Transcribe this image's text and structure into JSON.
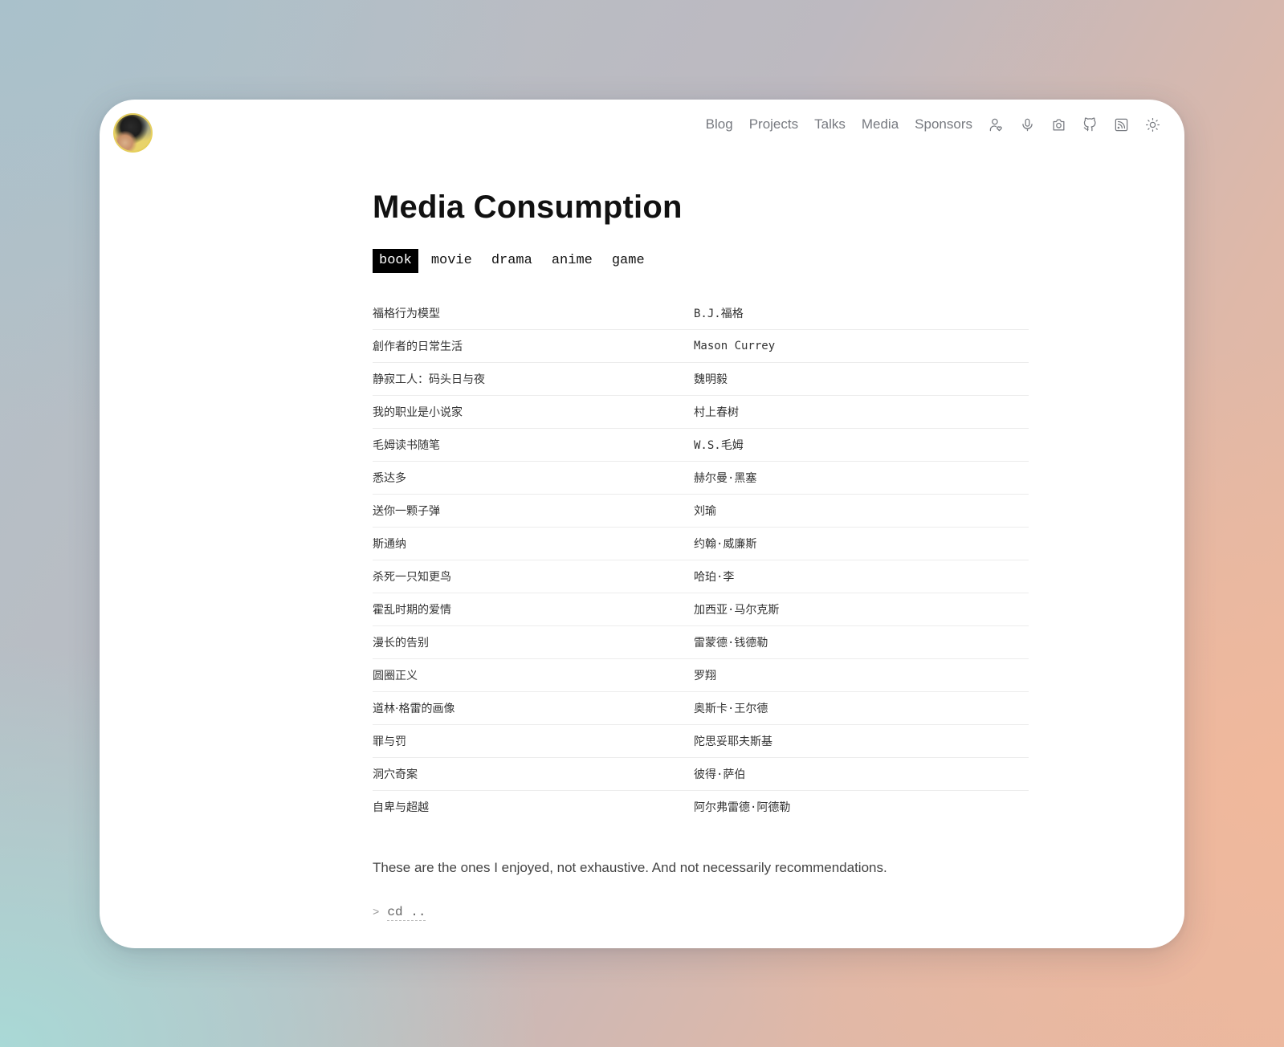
{
  "nav": {
    "links": [
      "Blog",
      "Projects",
      "Talks",
      "Media",
      "Sponsors"
    ],
    "icons": [
      "person-heart-icon",
      "microphone-icon",
      "camera-icon",
      "github-icon",
      "rss-icon",
      "sun-icon"
    ]
  },
  "page": {
    "title": "Media Consumption",
    "tabs": [
      "book",
      "movie",
      "drama",
      "anime",
      "game"
    ],
    "active_tab": "book",
    "books": [
      {
        "name": "福格行为模型",
        "author": "B.J.福格"
      },
      {
        "name": "創作者的日常生活",
        "author": "Mason Currey"
      },
      {
        "name": "静寂工人：码头日与夜",
        "author": "魏明毅"
      },
      {
        "name": "我的职业是小说家",
        "author": "村上春树"
      },
      {
        "name": "毛姆读书随笔",
        "author": "W.S.毛姆"
      },
      {
        "name": "悉达多",
        "author": "赫尔曼·黑塞"
      },
      {
        "name": "送你一颗子弹",
        "author": "刘瑜"
      },
      {
        "name": "斯通纳",
        "author": "约翰·威廉斯"
      },
      {
        "name": "杀死一只知更鸟",
        "author": "哈珀·李"
      },
      {
        "name": "霍乱时期的爱情",
        "author": "加西亚·马尔克斯"
      },
      {
        "name": "漫长的告别",
        "author": "雷蒙德·钱德勒"
      },
      {
        "name": "圆圈正义",
        "author": "罗翔"
      },
      {
        "name": "道林·格雷的画像",
        "author": "奥斯卡·王尔德"
      },
      {
        "name": "罪与罚",
        "author": "陀思妥耶夫斯基"
      },
      {
        "name": "洞穴奇案",
        "author": "彼得·萨伯"
      },
      {
        "name": "自卑与超越",
        "author": "阿尔弗雷德·阿德勒"
      }
    ],
    "note": "These are the ones I enjoyed, not exhaustive. And not necessarily recommendations.",
    "back_chevron": ">",
    "back_command": "cd .."
  },
  "colors": {
    "active_tab_bg": "#000000",
    "nav_text": "#777a80"
  }
}
